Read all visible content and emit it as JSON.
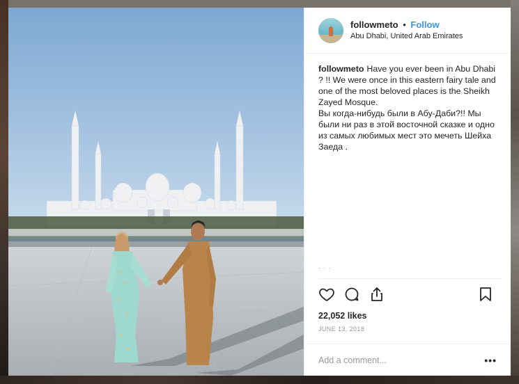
{
  "post": {
    "username": "followmeto",
    "separator": "•",
    "follow_label": "Follow",
    "location": "Abu Dhabi, United Arab Emirates",
    "caption_user": "followmeto",
    "caption_en": "Have you ever been in Abu Dhabi ? !! We were once in this eastern fairy tale and one of the most beloved places is the Sheikh Zayed Mosque.",
    "caption_ru": "Вы когда-нибудь были в Абу-Даби?!! Мы были ни раз в этой восточной сказке и одно из самых любимых мест это мечеть Шейха Заеда .",
    "likes": "22,052 likes",
    "date": "JUNE 13, 2018",
    "comment_placeholder": "Add a comment...",
    "more_label": "•••"
  },
  "icons": {
    "like": "heart-icon",
    "comment": "comment-icon",
    "share": "share-icon",
    "save": "bookmark-icon"
  },
  "colors": {
    "accent": "#3897f0",
    "text": "#262626",
    "muted": "#999999"
  }
}
